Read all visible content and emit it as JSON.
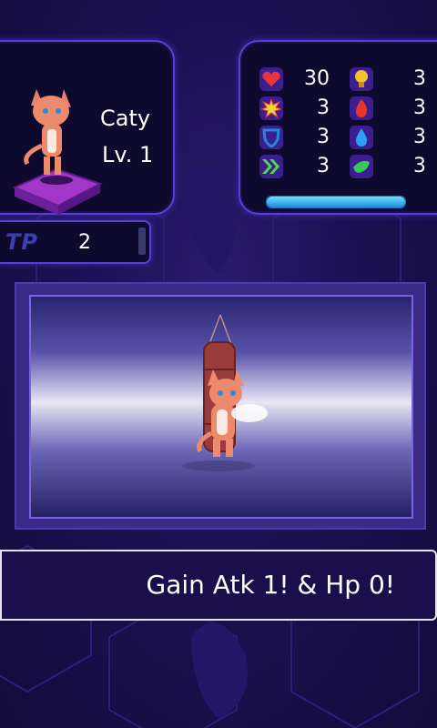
{
  "character": {
    "name": "Caty",
    "level": "Lv. 1"
  },
  "tp": {
    "label": "TP",
    "value": "2"
  },
  "stats": [
    {
      "icon": "heart-icon",
      "value": "30",
      "color": "#e8353b"
    },
    {
      "icon": "bulb-icon",
      "value": "3",
      "color": "#f5c030"
    },
    {
      "icon": "explosion-icon",
      "value": "3",
      "color": "#f6d03a"
    },
    {
      "icon": "fire-icon",
      "value": "3",
      "color": "#e8352b"
    },
    {
      "icon": "shield-icon",
      "value": "3",
      "color": "#1e8ad8"
    },
    {
      "icon": "water-drop-icon",
      "value": "3",
      "color": "#2d9ff0"
    },
    {
      "icon": "speed-arrows-icon",
      "value": "3",
      "color": "#4fd84a"
    },
    {
      "icon": "leaf-icon",
      "value": "3",
      "color": "#38c85a"
    }
  ],
  "hp_gauge": {
    "fill_fraction": 1.0
  },
  "message": "Gain Atk 1! & Hp 0!",
  "colors": {
    "panel_border": "#5a3fd6",
    "background": "#1c1153"
  }
}
